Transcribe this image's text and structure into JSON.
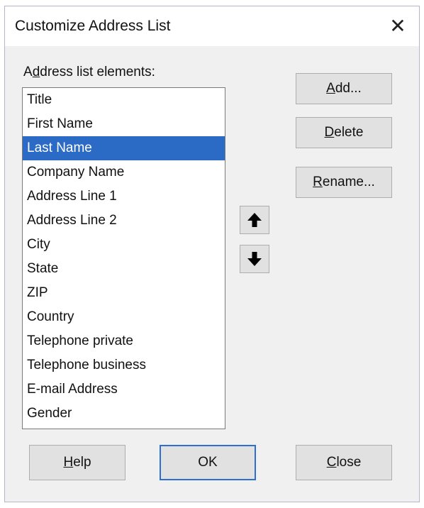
{
  "dialog": {
    "title": "Customize Address List",
    "close_icon": "close-icon"
  },
  "list": {
    "label_access": "A",
    "label_d": "d",
    "label_rest": "dress list elements:",
    "items": [
      "Title",
      "First Name",
      "Last Name",
      "Company Name",
      "Address Line 1",
      "Address Line 2",
      "City",
      "State",
      "ZIP",
      "Country",
      "Telephone private",
      "Telephone business",
      "E-mail Address",
      "Gender"
    ],
    "selected_item": "Last Name"
  },
  "side_buttons": {
    "add": {
      "key": "A",
      "rest": "dd..."
    },
    "delete": {
      "key": "D",
      "rest": "elete"
    },
    "rename": {
      "key": "R",
      "rest": "ename..."
    }
  },
  "arrows": {
    "up_icon": "arrow-up-icon",
    "down_icon": "arrow-down-icon"
  },
  "bottom_buttons": {
    "help": {
      "key": "H",
      "rest": "elp"
    },
    "ok": "OK",
    "close": {
      "key": "C",
      "rest": "lose"
    }
  },
  "colors": {
    "selection": "#2b6bc5",
    "default_button_border": "#2c6fd0"
  }
}
